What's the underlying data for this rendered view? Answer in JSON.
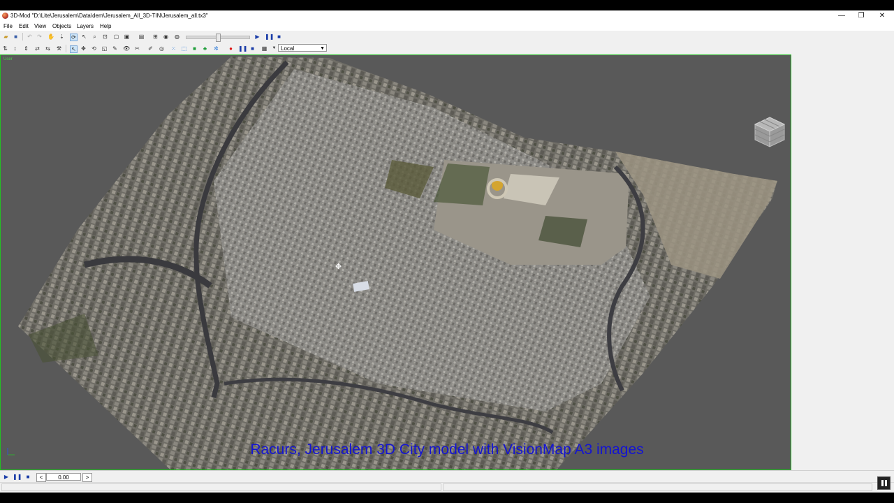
{
  "window": {
    "title": "3D-Mod \"D:\\Lite\\Jerusalem\\Data\\dem\\Jerusalem_All_3D-TIN\\Jerusalem_all.tx3\"",
    "minimize": "—",
    "restore": "❐",
    "close": "✕"
  },
  "menu": [
    "File",
    "Edit",
    "View",
    "Objects",
    "Layers",
    "Help"
  ],
  "toolbar": {
    "coord_system": "Local"
  },
  "viewport": {
    "label": "User",
    "caption": "Racurs, Jerusalem 3D City model with VisionMap A3 images",
    "background_color": "#595959",
    "border_color": "#22c022"
  },
  "playback": {
    "prev_label": "<",
    "next_label": ">",
    "time_value": "0.00"
  },
  "icons": [
    "open-icon",
    "save-icon",
    "undo-icon",
    "redo-icon",
    "pan-icon",
    "zoom-icon",
    "rotate-icon",
    "play-icon",
    "pause-icon",
    "stop-icon",
    "record-icon",
    "select-icon",
    "move-icon",
    "view-cube-icon"
  ]
}
